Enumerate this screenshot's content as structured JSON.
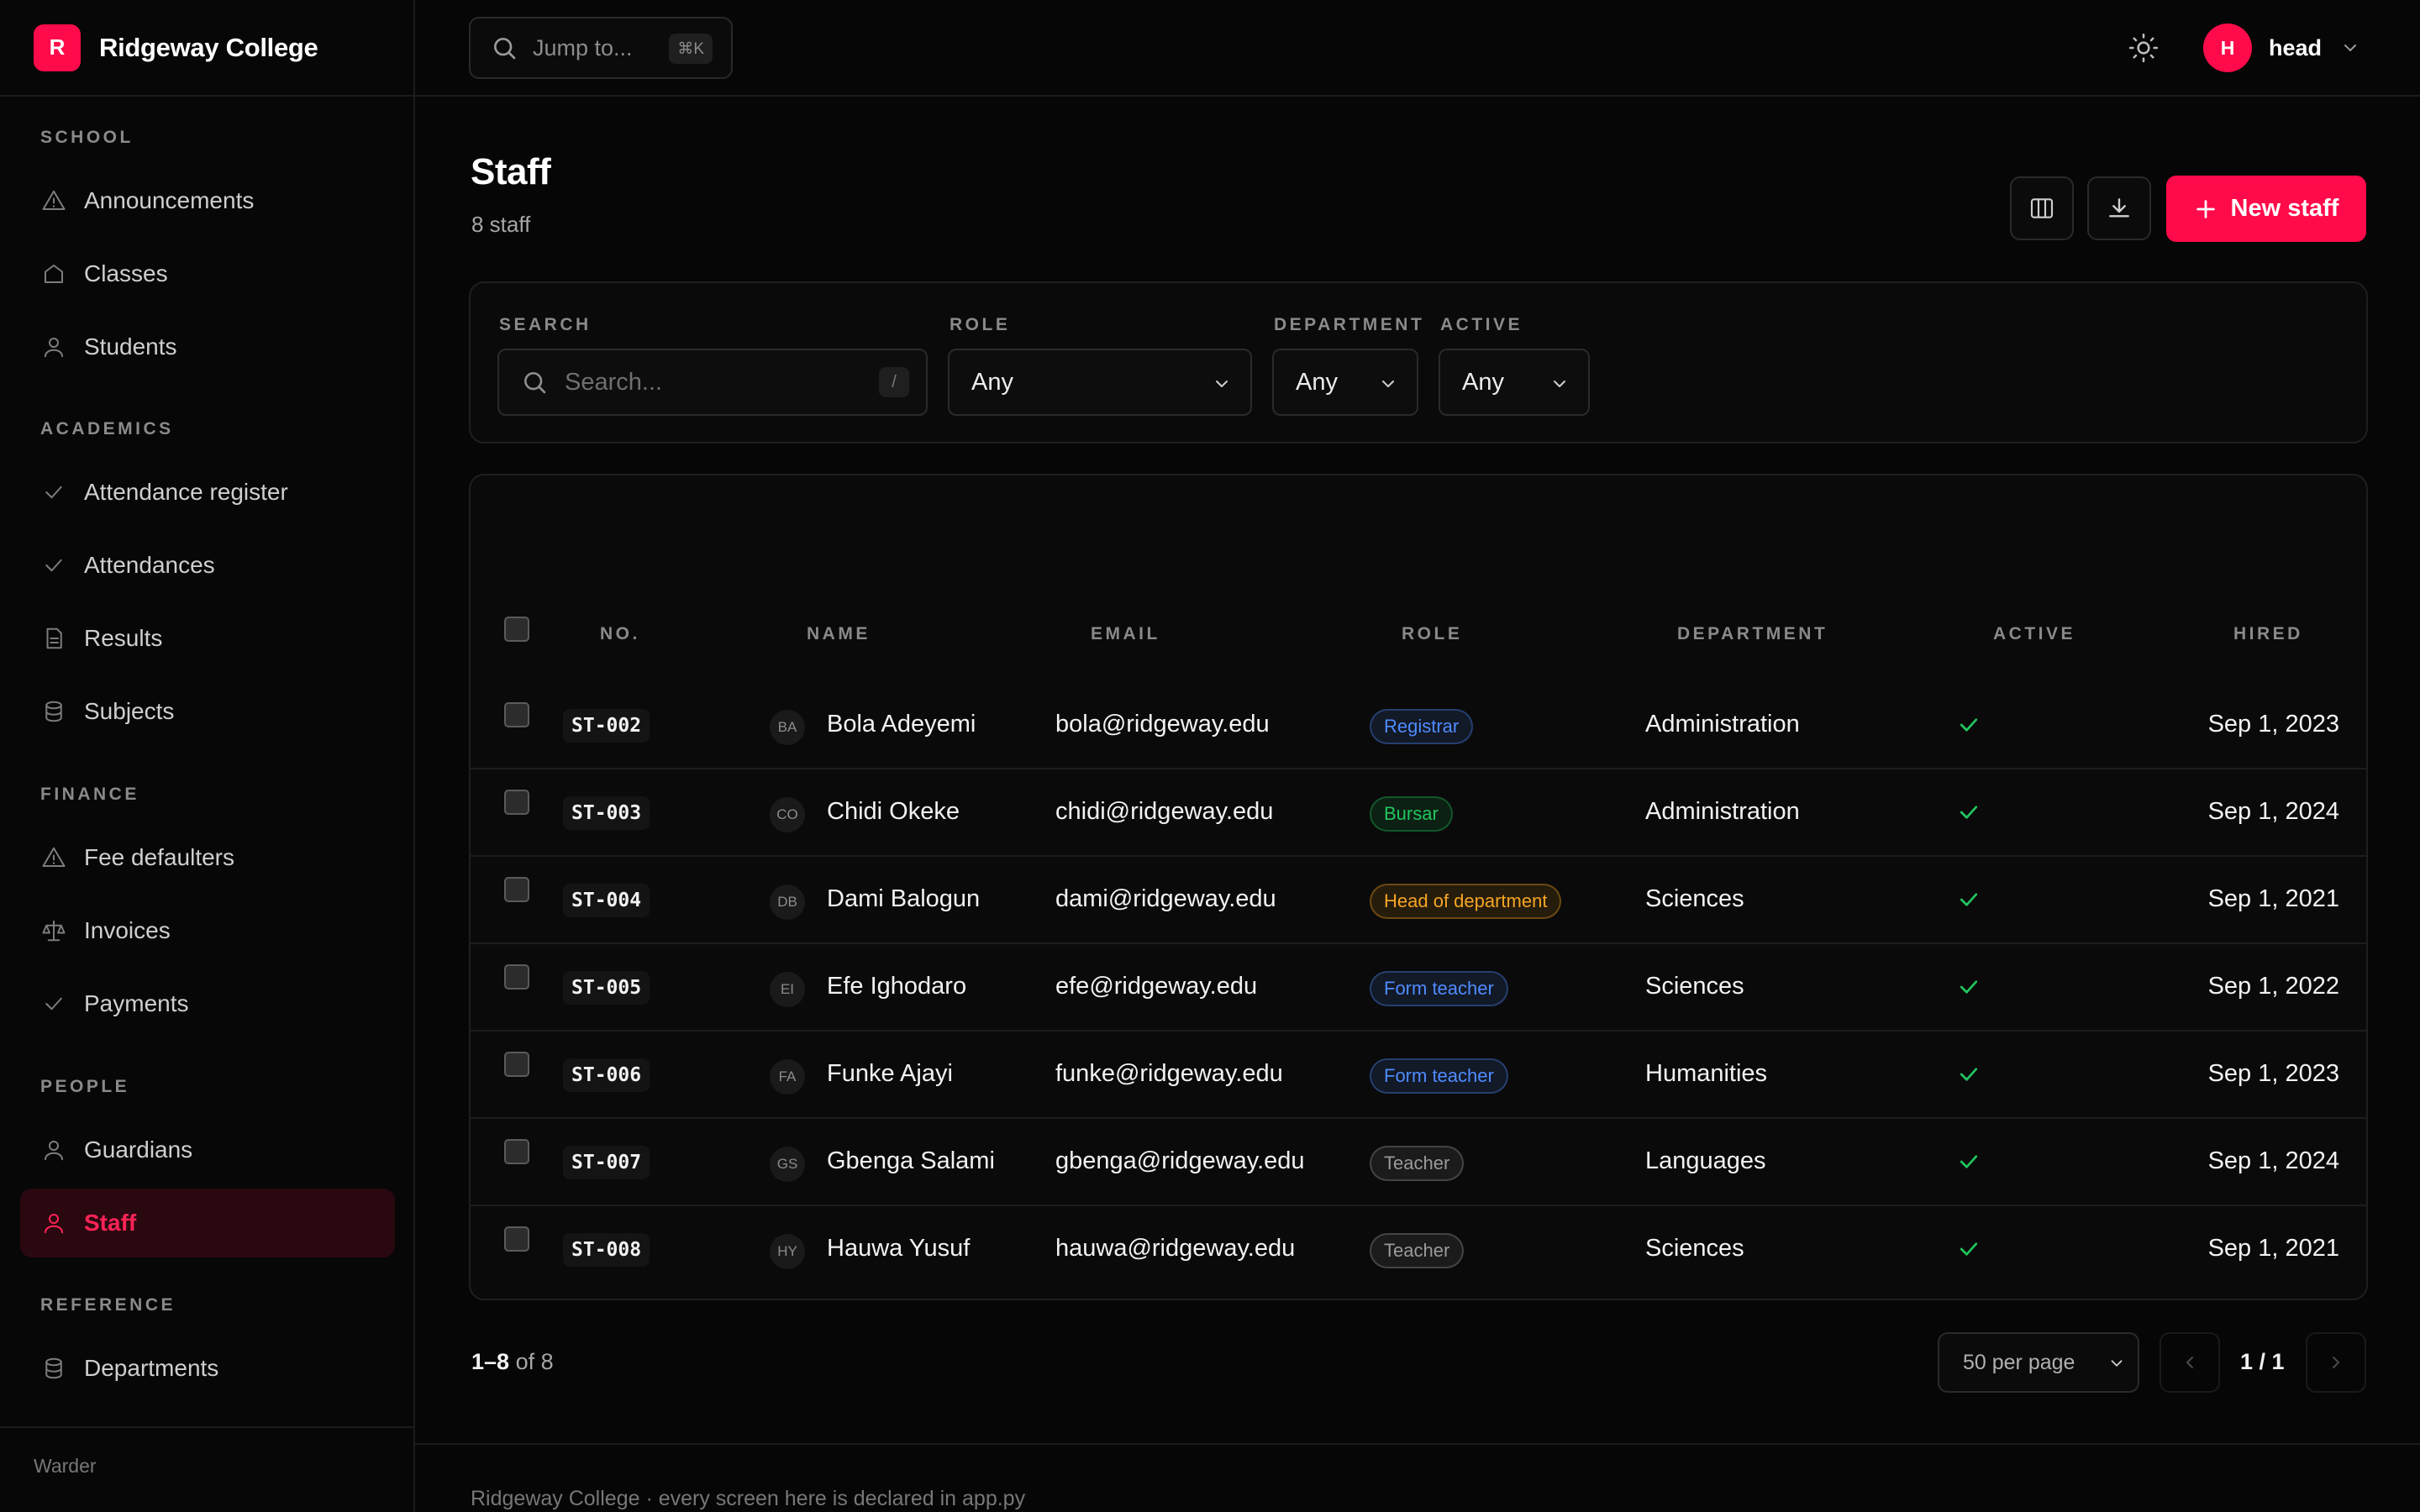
{
  "brand": {
    "logo_letter": "R",
    "name": "Ridgeway College",
    "accent": "#ff0a4a"
  },
  "topbar": {
    "search_placeholder": "Jump to...",
    "shortcut": "⌘K",
    "user_initial": "H",
    "user_name": "head"
  },
  "sidebar": {
    "sections": [
      {
        "title": "SCHOOL",
        "items": [
          {
            "label": "Announcements",
            "icon": "alert-triangle-icon"
          },
          {
            "label": "Classes",
            "icon": "home-icon"
          },
          {
            "label": "Students",
            "icon": "user-icon"
          }
        ]
      },
      {
        "title": "ACADEMICS",
        "items": [
          {
            "label": "Attendance register",
            "icon": "check-icon"
          },
          {
            "label": "Attendances",
            "icon": "check-icon"
          },
          {
            "label": "Results",
            "icon": "document-icon"
          },
          {
            "label": "Subjects",
            "icon": "database-icon"
          }
        ]
      },
      {
        "title": "FINANCE",
        "items": [
          {
            "label": "Fee defaulters",
            "icon": "alert-triangle-icon"
          },
          {
            "label": "Invoices",
            "icon": "scale-icon"
          },
          {
            "label": "Payments",
            "icon": "check-icon"
          }
        ]
      },
      {
        "title": "PEOPLE",
        "items": [
          {
            "label": "Guardians",
            "icon": "user-icon"
          },
          {
            "label": "Staff",
            "icon": "user-icon",
            "active": true
          }
        ]
      },
      {
        "title": "REFERENCE",
        "items": [
          {
            "label": "Departments",
            "icon": "database-icon"
          }
        ]
      }
    ],
    "footer": "Warder"
  },
  "page": {
    "title": "Staff",
    "subtitle": "8 staff",
    "new_button": "New staff"
  },
  "filters": {
    "search": {
      "label": "SEARCH",
      "placeholder": "Search...",
      "shortcut": "/"
    },
    "role": {
      "label": "ROLE",
      "value": "Any"
    },
    "department": {
      "label": "DEPARTMENT",
      "value": "Any"
    },
    "active": {
      "label": "ACTIVE",
      "value": "Any"
    }
  },
  "table": {
    "columns": [
      "NO.",
      "NAME",
      "EMAIL",
      "ROLE",
      "DEPARTMENT",
      "ACTIVE",
      "HIRED"
    ],
    "role_colors": {
      "Registrar": "#4f8cff",
      "Bursar": "#22c55e",
      "Head of department": "#f5a524",
      "Form teacher": "#4f8cff",
      "Teacher": "#9a9a9a"
    },
    "rows": [
      {
        "no": "ST-002",
        "initials": "BA",
        "name": "Bola Adeyemi",
        "email": "bola@ridgeway.edu",
        "role": "Registrar",
        "department": "Administration",
        "active": true,
        "hired": "Sep 1, 2023"
      },
      {
        "no": "ST-003",
        "initials": "CO",
        "name": "Chidi Okeke",
        "email": "chidi@ridgeway.edu",
        "role": "Bursar",
        "department": "Administration",
        "active": true,
        "hired": "Sep 1, 2024"
      },
      {
        "no": "ST-004",
        "initials": "DB",
        "name": "Dami Balogun",
        "email": "dami@ridgeway.edu",
        "role": "Head of department",
        "department": "Sciences",
        "active": true,
        "hired": "Sep 1, 2021"
      },
      {
        "no": "ST-005",
        "initials": "EI",
        "name": "Efe Ighodaro",
        "email": "efe@ridgeway.edu",
        "role": "Form teacher",
        "department": "Sciences",
        "active": true,
        "hired": "Sep 1, 2022"
      },
      {
        "no": "ST-006",
        "initials": "FA",
        "name": "Funke Ajayi",
        "email": "funke@ridgeway.edu",
        "role": "Form teacher",
        "department": "Humanities",
        "active": true,
        "hired": "Sep 1, 2023"
      },
      {
        "no": "ST-007",
        "initials": "GS",
        "name": "Gbenga Salami",
        "email": "gbenga@ridgeway.edu",
        "role": "Teacher",
        "department": "Languages",
        "active": true,
        "hired": "Sep 1, 2024"
      },
      {
        "no": "ST-008",
        "initials": "HY",
        "name": "Hauwa Yusuf",
        "email": "hauwa@ridgeway.edu",
        "role": "Teacher",
        "department": "Sciences",
        "active": true,
        "hired": "Sep 1, 2021"
      }
    ]
  },
  "pagination": {
    "range": "1–8",
    "of_text": "of 8",
    "per_page": "50 per page",
    "page_indicator": "1 / 1"
  },
  "footer": "Ridgeway College · every screen here is declared in app.py"
}
